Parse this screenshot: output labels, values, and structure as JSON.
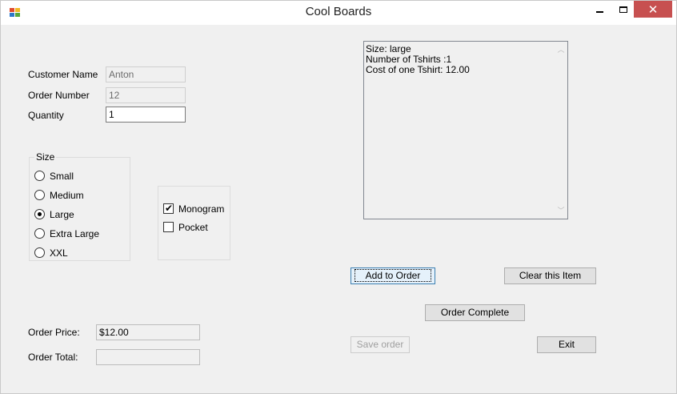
{
  "window": {
    "title": "Cool Boards",
    "close_glyph": "✕"
  },
  "fields": {
    "customer_name_label": "Customer Name",
    "customer_name_value": "Anton",
    "order_number_label": "Order Number",
    "order_number_value": "12",
    "quantity_label": "Quantity",
    "quantity_value": "1"
  },
  "size_group": {
    "title": "Size",
    "options": [
      {
        "label": "Small",
        "selected": false
      },
      {
        "label": "Medium",
        "selected": false
      },
      {
        "label": "Large",
        "selected": true
      },
      {
        "label": "Extra Large",
        "selected": false
      },
      {
        "label": "XXL",
        "selected": false
      }
    ]
  },
  "extras": [
    {
      "label": "Monogram",
      "checked": true
    },
    {
      "label": "Pocket",
      "checked": false
    }
  ],
  "summary_lines": [
    "Size: large",
    "Number of Tshirts :1",
    "Cost of one Tshirt: 12.00"
  ],
  "buttons": {
    "add_to_order": "Add to Order",
    "clear_item": "Clear this Item",
    "order_complete": "Order Complete",
    "save_order": "Save order",
    "exit": "Exit"
  },
  "totals": {
    "order_price_label": "Order Price:",
    "order_price_value": "$12.00",
    "order_total_label": "Order Total:",
    "order_total_value": ""
  }
}
